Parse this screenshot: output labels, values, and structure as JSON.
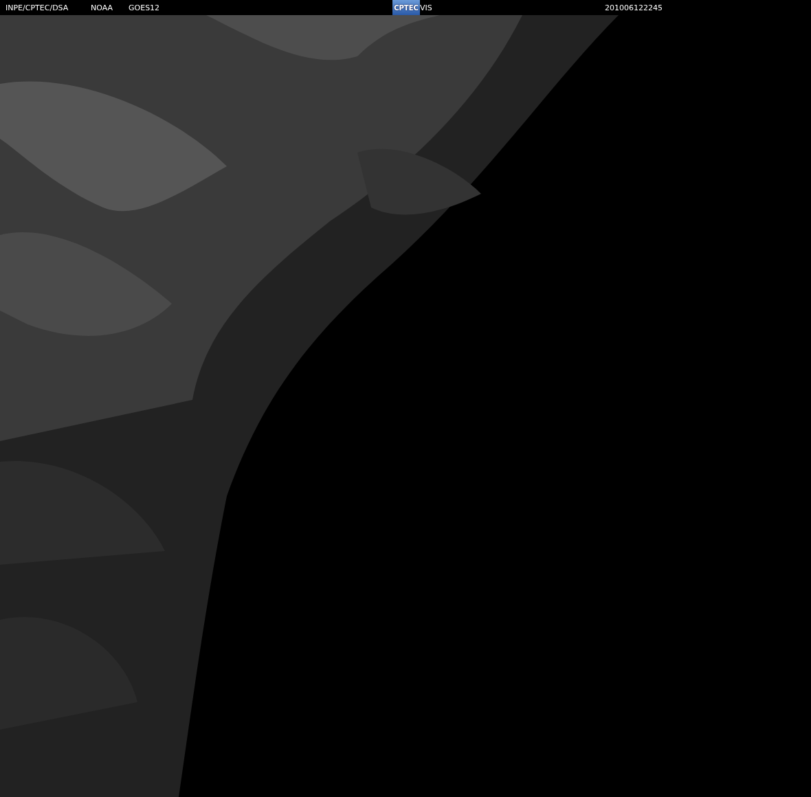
{
  "header": {
    "agency": "INPE/CPTEC/DSA",
    "operator": "NOAA",
    "satellite": "GOES12",
    "logo": "CPTEC",
    "channel": "VIS",
    "timestamp": "201006122245"
  }
}
